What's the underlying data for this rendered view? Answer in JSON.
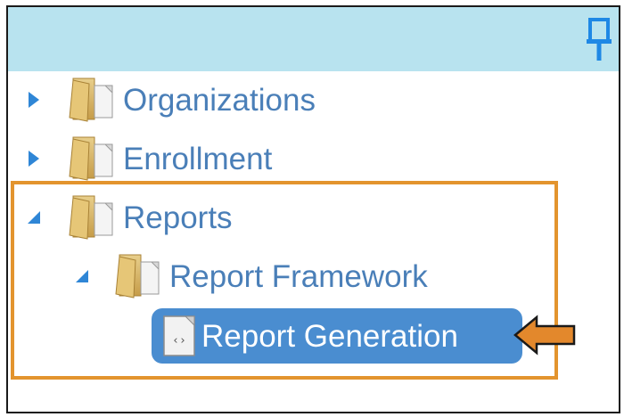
{
  "panel": {
    "pin_icon": "pin-icon",
    "colors": {
      "header_bg": "#b8e3ef",
      "link_text": "#4a7fb8",
      "selected_bg": "#4a8dd0",
      "highlight": "#e3942e"
    }
  },
  "tree": {
    "organizations": {
      "label": "Organizations",
      "state": "collapsed",
      "icon": "folder-icon"
    },
    "enrollment": {
      "label": "Enrollment",
      "state": "collapsed",
      "icon": "folder-icon"
    },
    "reports": {
      "label": "Reports",
      "state": "expanded",
      "icon": "folder-icon"
    },
    "report_framework": {
      "label": "Report Framework",
      "state": "expanded",
      "icon": "folder-icon"
    },
    "report_generation": {
      "label": "Report Generation",
      "state": "selected",
      "icon": "page-code-icon"
    }
  }
}
